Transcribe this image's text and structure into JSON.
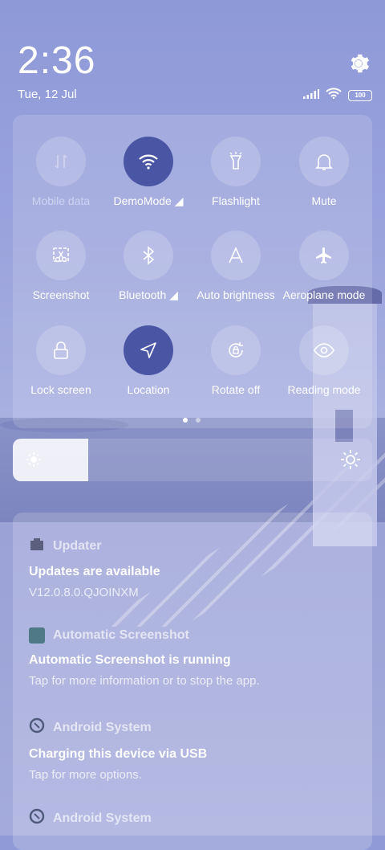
{
  "status": {
    "time": "2:36",
    "date": "Tue, 12 Jul",
    "battery": "100",
    "icons": [
      "signal-icon",
      "wifi-icon",
      "battery-icon"
    ]
  },
  "quick_settings": {
    "tiles": [
      {
        "label": "Mobile data",
        "icon": "mobile-data-icon",
        "state": "disabled"
      },
      {
        "label": "DemoMode",
        "icon": "wifi-icon",
        "state": "on"
      },
      {
        "label": "Flashlight",
        "icon": "flashlight-icon",
        "state": "off"
      },
      {
        "label": "Mute",
        "icon": "bell-icon",
        "state": "off"
      },
      {
        "label": "Screenshot",
        "icon": "scissors-icon",
        "state": "off"
      },
      {
        "label": "Bluetooth",
        "icon": "bluetooth-icon",
        "state": "off"
      },
      {
        "label": "Auto brightness",
        "icon": "auto-brightness-icon",
        "state": "off"
      },
      {
        "label": "Aeroplane mode",
        "icon": "airplane-icon",
        "state": "off"
      },
      {
        "label": "Lock screen",
        "icon": "lock-icon",
        "state": "off"
      },
      {
        "label": "Location",
        "icon": "location-icon",
        "state": "on"
      },
      {
        "label": "Rotate off",
        "icon": "rotate-icon",
        "state": "off"
      },
      {
        "label": "Reading mode",
        "icon": "eye-icon",
        "state": "off"
      }
    ],
    "page_count": 2,
    "current_page": 1
  },
  "brightness": {
    "level_fraction": 0.21
  },
  "notifications": [
    {
      "app": "Updater",
      "title": "Updates are available",
      "body": "V12.0.8.0.QJOINXM"
    },
    {
      "app": "Automatic Screenshot",
      "title": "Automatic Screenshot is running",
      "body": "Tap for more information or to stop the app."
    },
    {
      "app": "Android System",
      "title": "Charging this device via USB",
      "body": "Tap for more options."
    },
    {
      "app": "Android System",
      "title": "",
      "body": ""
    }
  ],
  "colors": {
    "accent_on": "#4a56a4",
    "background": "#8f9ad6"
  }
}
